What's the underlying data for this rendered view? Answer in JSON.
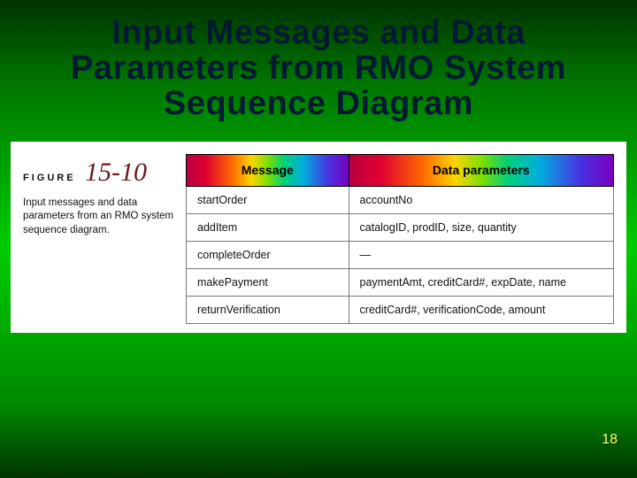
{
  "title": "Input Messages and Data Parameters from RMO System Sequence Diagram",
  "figure": {
    "label": "FIGURE",
    "number": "15-10",
    "caption": "Input messages and data parameters from an RMO system sequence diagram."
  },
  "table": {
    "headers": {
      "col1": "Message",
      "col2": "Data parameters"
    },
    "rows": [
      {
        "message": "startOrder",
        "params": "accountNo"
      },
      {
        "message": "addItem",
        "params": "catalogID, prodID, size, quantity"
      },
      {
        "message": "completeOrder",
        "params": "—"
      },
      {
        "message": "makePayment",
        "params": "paymentAmt, creditCard#, expDate, name"
      },
      {
        "message": "returnVerification",
        "params": "creditCard#, verificationCode, amount"
      }
    ]
  },
  "pageNumber": "18",
  "footer": "System Analysis and Design Jess Role 2004@ Prentice Hall"
}
